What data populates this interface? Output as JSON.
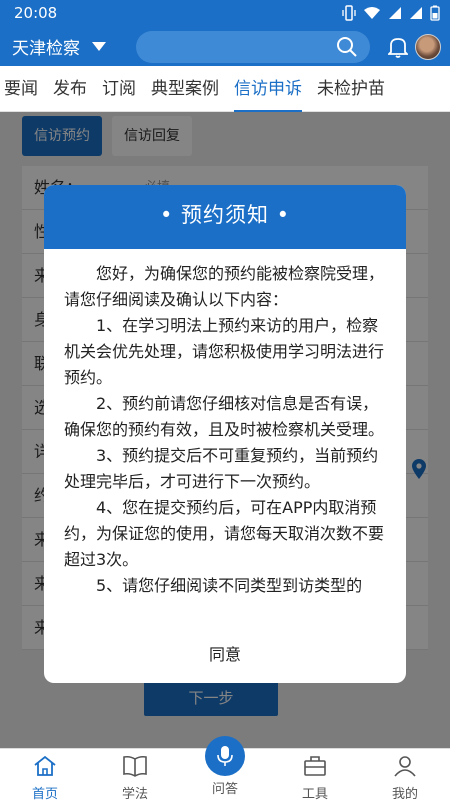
{
  "status_bar": {
    "time": "20:08"
  },
  "header": {
    "region": "天津检察",
    "search_placeholder": ""
  },
  "tabs": [
    {
      "label": "要闻",
      "active": false
    },
    {
      "label": "发布",
      "active": false
    },
    {
      "label": "订阅",
      "active": false
    },
    {
      "label": "典型案例",
      "active": false
    },
    {
      "label": "信访申诉",
      "active": true
    },
    {
      "label": "未检护苗",
      "active": false
    }
  ],
  "subtabs": [
    {
      "label": "信访预约",
      "active": true
    },
    {
      "label": "信访回复",
      "active": false
    }
  ],
  "form_rows": [
    "姓名：",
    "性",
    "来",
    "身",
    "联",
    "选",
    "详",
    "约",
    "来",
    "来",
    "来"
  ],
  "form_name_value": "必填",
  "next_button": "下一步",
  "modal": {
    "title": "• 预约须知 •",
    "paragraphs": [
      "您好，为确保您的预约能被检察院受理，请您仔细阅读及确认以下内容：",
      "1、在学习明法上预约来访的用户，检察机关会优先处理，请您积极使用学习明法进行预约。",
      "2、预约前请您仔细核对信息是否有误，确保您的预约有效，且及时被检察机关受理。",
      "3、预约提交后不可重复预约，当前预约处理完毕后，才可进行下一次预约。",
      "4、您在提交预约后，可在APP内取消预约，为保证您的使用，请您每天取消次数不要超过3次。",
      "5、请您仔细阅读不同类型到访类型的"
    ],
    "agree_label": "同意"
  },
  "bottom_nav": [
    {
      "label": "首页",
      "icon": "home-icon",
      "active": true
    },
    {
      "label": "学法",
      "icon": "book-icon",
      "active": false
    },
    {
      "label": "问答",
      "icon": "mic-icon",
      "active": false
    },
    {
      "label": "工具",
      "icon": "toolbox-icon",
      "active": false
    },
    {
      "label": "我的",
      "icon": "user-icon",
      "active": false
    }
  ],
  "colors": {
    "primary": "#1c6fc6",
    "overlay": "rgba(0,0,0,0.48)"
  }
}
